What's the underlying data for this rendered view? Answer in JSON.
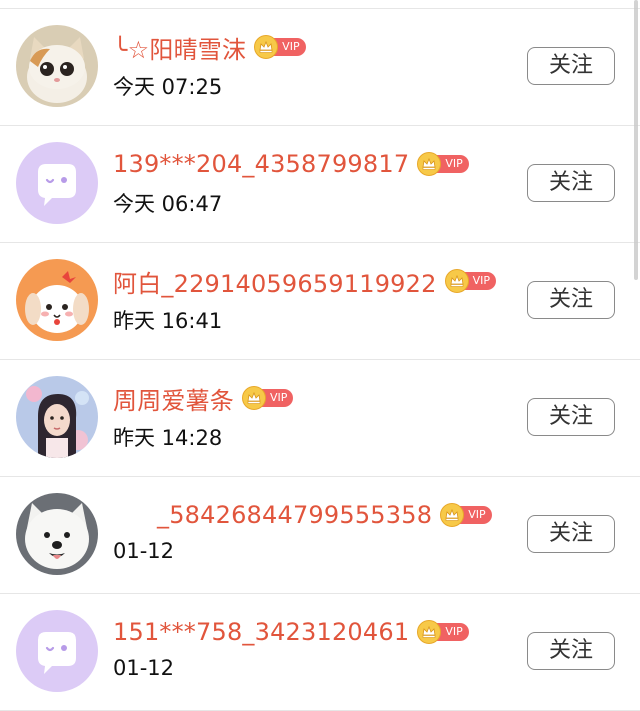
{
  "followers": [
    {
      "name": "╰☆阳晴雪沫",
      "vip": "VIP",
      "time": "今天 07:25",
      "follow_label": "关注",
      "avatar": "cat-photo"
    },
    {
      "name": "139***204_4358799817",
      "vip": "VIP",
      "time": "今天 06:47",
      "follow_label": "关注",
      "avatar": "default-purple-bubble"
    },
    {
      "name": "阿白_22914059659119922",
      "vip": "VIP",
      "time": "昨天 16:41",
      "follow_label": "关注",
      "avatar": "cartoon-dog"
    },
    {
      "name": "周周爱薯条",
      "vip": "VIP",
      "time": "昨天 14:28",
      "follow_label": "关注",
      "avatar": "girl-photo"
    },
    {
      "name": "_58426844799555358",
      "vip": "VIP",
      "time": "01-12",
      "follow_label": "关注",
      "avatar": "samoyed-photo"
    },
    {
      "name": "151***758_3423120461",
      "vip": "VIP",
      "time": "01-12",
      "follow_label": "关注",
      "avatar": "default-purple-bubble"
    }
  ],
  "colors": {
    "name": "#e1553c",
    "vip_tag": "#f06262",
    "crown": "#f7c948",
    "default_avatar": "#d9c7f5"
  }
}
